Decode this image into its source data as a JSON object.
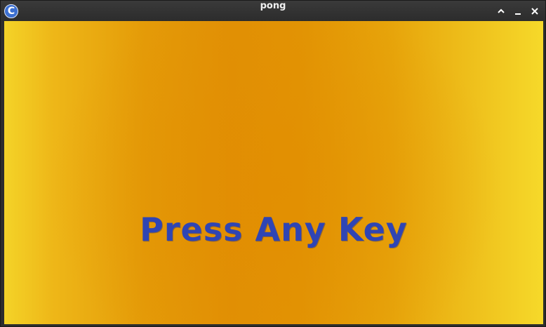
{
  "window": {
    "title": "pong",
    "app_icon_glyph": "C"
  },
  "controls": {
    "maximize_icon": "chevron-up-icon",
    "minimize_icon": "minimize-icon",
    "close_icon": "close-icon"
  },
  "game": {
    "prompt": "Press Any Key",
    "colors": {
      "background_edge": "#f6d92a",
      "background_center": "#e19005",
      "text": "#2f45b4"
    }
  }
}
